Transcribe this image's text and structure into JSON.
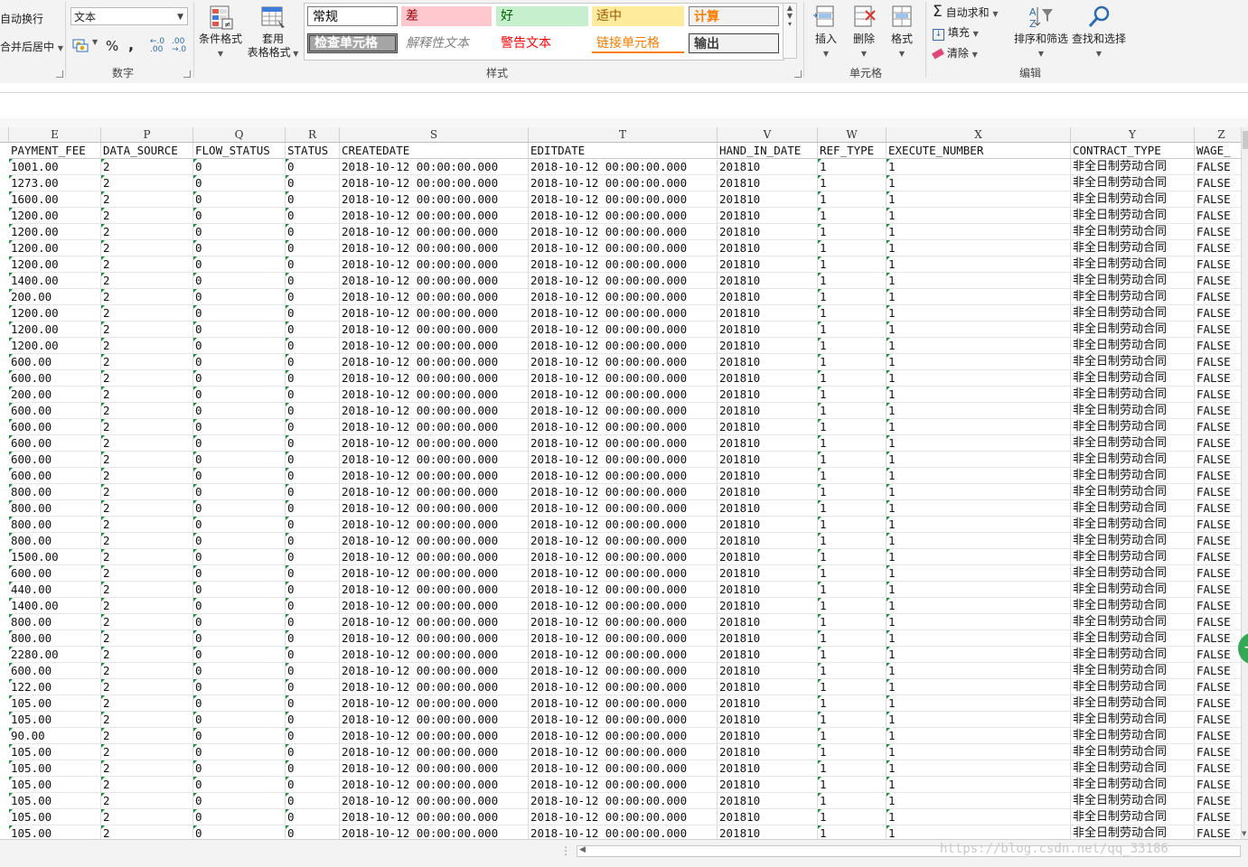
{
  "ribbon": {
    "alignment": {
      "wrap_text": "自动换行",
      "merge_center": "合并后居中"
    },
    "number": {
      "format_value": "文本",
      "percent": "%",
      "comma": ",",
      "inc_decimal": "←.0 .00",
      "dec_decimal": ".00 →.0",
      "label": "数字"
    },
    "styles": {
      "conditional_format": "条件格式",
      "table_format_line1": "套用",
      "table_format_line2": "表格格式",
      "gallery": {
        "normal": "常规",
        "bad": "差",
        "good": "好",
        "neutral": "适中",
        "calculation": "计算",
        "check_cell": "检查单元格",
        "explanatory": "解释性文本",
        "warning": "警告文本",
        "linked_cell": "链接单元格",
        "output": "输出"
      },
      "label": "样式"
    },
    "cells": {
      "insert": "插入",
      "delete": "删除",
      "format": "格式",
      "label": "单元格"
    },
    "editing": {
      "autosum": "自动求和",
      "fill": "填充",
      "clear": "清除",
      "sort_filter": "排序和筛选",
      "find_select": "查找和选择",
      "label": "编辑"
    }
  },
  "sheet": {
    "column_letters": [
      "E",
      "P",
      "Q",
      "R",
      "S",
      "T",
      "V",
      "W",
      "X",
      "Y",
      "Z"
    ],
    "headers": [
      "PAYMENT_FEE",
      "DATA_SOURCE",
      "FLOW_STATUS",
      "STATUS",
      "CREATEDATE",
      "EDITDATE",
      "HAND_IN_DATE",
      "REF_TYPE",
      "EXECUTE_NUMBER",
      "CONTRACT_TYPE",
      "WAGE_"
    ],
    "constant": {
      "data_source": "2",
      "flow_status": "0",
      "status": "0",
      "createdate": "2018-10-12 00:00:00.000",
      "editdate": "2018-10-12 00:00:00.000",
      "hand_in_date": "201810",
      "ref_type": "1",
      "execute_number": "1",
      "contract_type": "非全日制劳动合同",
      "wage": "FALSE"
    },
    "payment_fees": [
      "1001.00",
      "1273.00",
      "1600.00",
      "1200.00",
      "1200.00",
      "1200.00",
      "1200.00",
      "1400.00",
      "200.00",
      "1200.00",
      "1200.00",
      "1200.00",
      "600.00",
      "600.00",
      "200.00",
      "600.00",
      "600.00",
      "600.00",
      "600.00",
      "600.00",
      "800.00",
      "800.00",
      "800.00",
      "800.00",
      "1500.00",
      "600.00",
      "440.00",
      "1400.00",
      "800.00",
      "800.00",
      "2280.00",
      "600.00",
      "122.00",
      "105.00",
      "105.00",
      "90.00",
      "105.00",
      "105.00",
      "105.00",
      "105.00",
      "105.00",
      "105.00"
    ]
  },
  "watermark": "https://blog.csdn.net/qq_33186",
  "colors": {
    "green_triangle": "#1e8a3a",
    "bad_bg": "#ffc7ce",
    "good_bg": "#c6efce",
    "neutral_bg": "#ffeb9c"
  }
}
